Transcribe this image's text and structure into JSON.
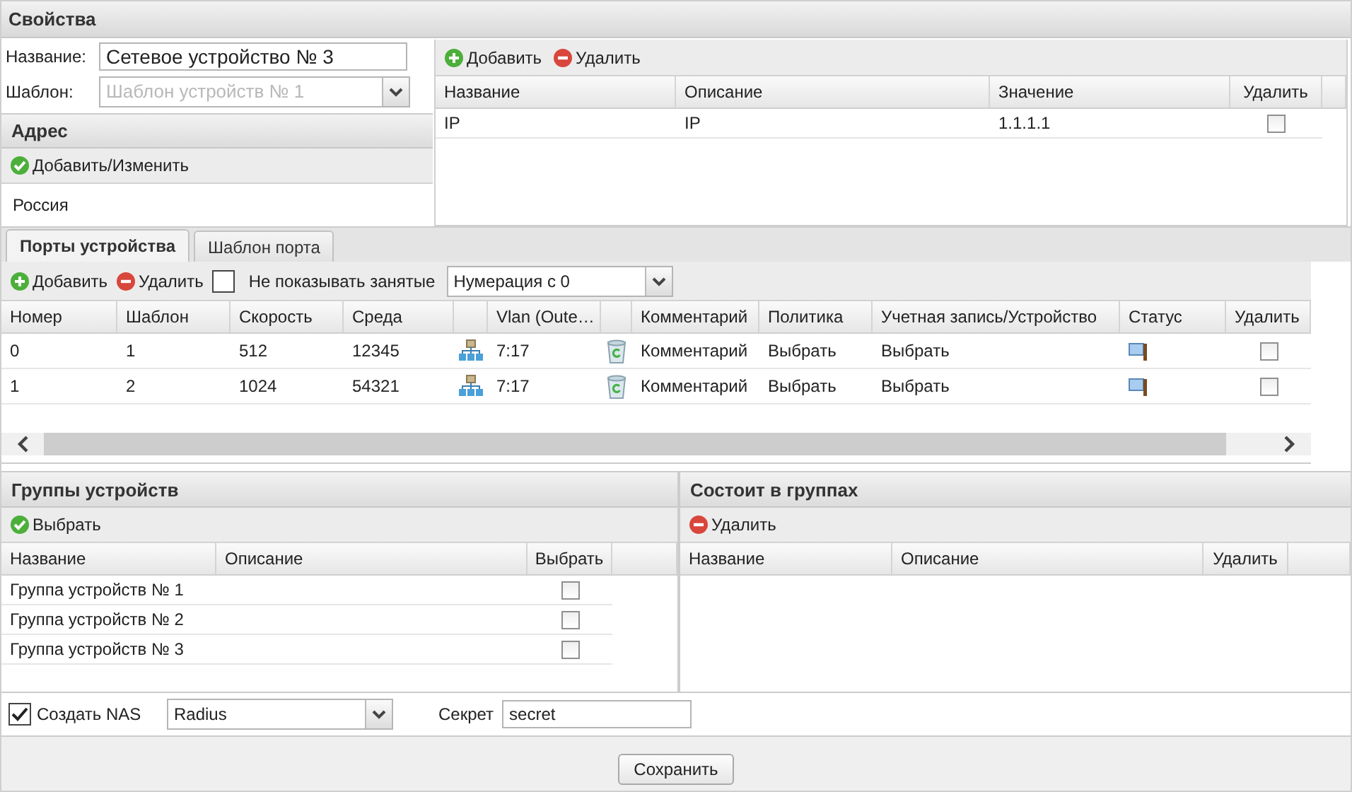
{
  "panel_title": "Свойства",
  "name_field": {
    "label": "Название:",
    "value": "Сетевое устройство № 3"
  },
  "template_field": {
    "label": "Шаблон:",
    "value": "Шаблон устройств № 1",
    "disabled": true
  },
  "address": {
    "title": "Адрес",
    "button": {
      "kind": "select",
      "label": "Добавить/Изменить"
    },
    "value": "Россия"
  },
  "params": {
    "toolbar": [
      {
        "kind": "add",
        "label": "Добавить"
      },
      {
        "kind": "remove",
        "label": "Удалить"
      }
    ],
    "columns": [
      "Название",
      "Описание",
      "Значение",
      "Удалить"
    ],
    "rows": [
      {
        "name": "IP",
        "description": "IP",
        "value": "1.1.1.1",
        "checked": false
      }
    ]
  },
  "tabs": [
    {
      "label": "Порты устройства",
      "selected": true
    },
    {
      "label": "Шаблон порта",
      "selected": false
    }
  ],
  "ports": {
    "toolbar": [
      {
        "kind": "add",
        "label": "Добавить"
      },
      {
        "kind": "remove",
        "label": "Удалить"
      }
    ],
    "hide_busy": {
      "label": "Не показывать занятые",
      "checked": false
    },
    "numbering": "Нумерация с 0",
    "columns": [
      "Номер",
      "Шаблон",
      "Скорость",
      "Среда",
      "Vlan (Oute…",
      "Комментарий",
      "Политика",
      "Учетная запись/Устройство",
      "Статус",
      "Удалить"
    ],
    "rows": [
      {
        "number": "0",
        "template": "1",
        "speed": "512",
        "medium": "12345",
        "vlan": "7:17",
        "comment": "Комментарий",
        "policy": "Выбрать",
        "account": "Выбрать",
        "checked": false
      },
      {
        "number": "1",
        "template": "2",
        "speed": "1024",
        "medium": "54321",
        "vlan": "7:17",
        "comment": "Комментарий",
        "policy": "Выбрать",
        "account": "Выбрать",
        "checked": false
      }
    ]
  },
  "device_groups": {
    "title": "Группы устройств",
    "button": {
      "kind": "select",
      "label": "Выбрать"
    },
    "columns": [
      "Название",
      "Описание",
      "Выбрать"
    ],
    "rows": [
      {
        "name": "Группа устройств № 1",
        "checked": false
      },
      {
        "name": "Группа устройств № 2",
        "checked": false
      },
      {
        "name": "Группа устройств № 3",
        "checked": false
      }
    ]
  },
  "member_of": {
    "title": "Состоит в группах",
    "button": {
      "kind": "remove",
      "label": "Удалить"
    },
    "columns": [
      "Название",
      "Описание",
      "Удалить"
    ]
  },
  "nas": {
    "label": "Создать NAS",
    "checked": true,
    "protocol": "Radius",
    "secret_label": "Секрет",
    "secret": "secret"
  },
  "save_button": "Сохранить"
}
